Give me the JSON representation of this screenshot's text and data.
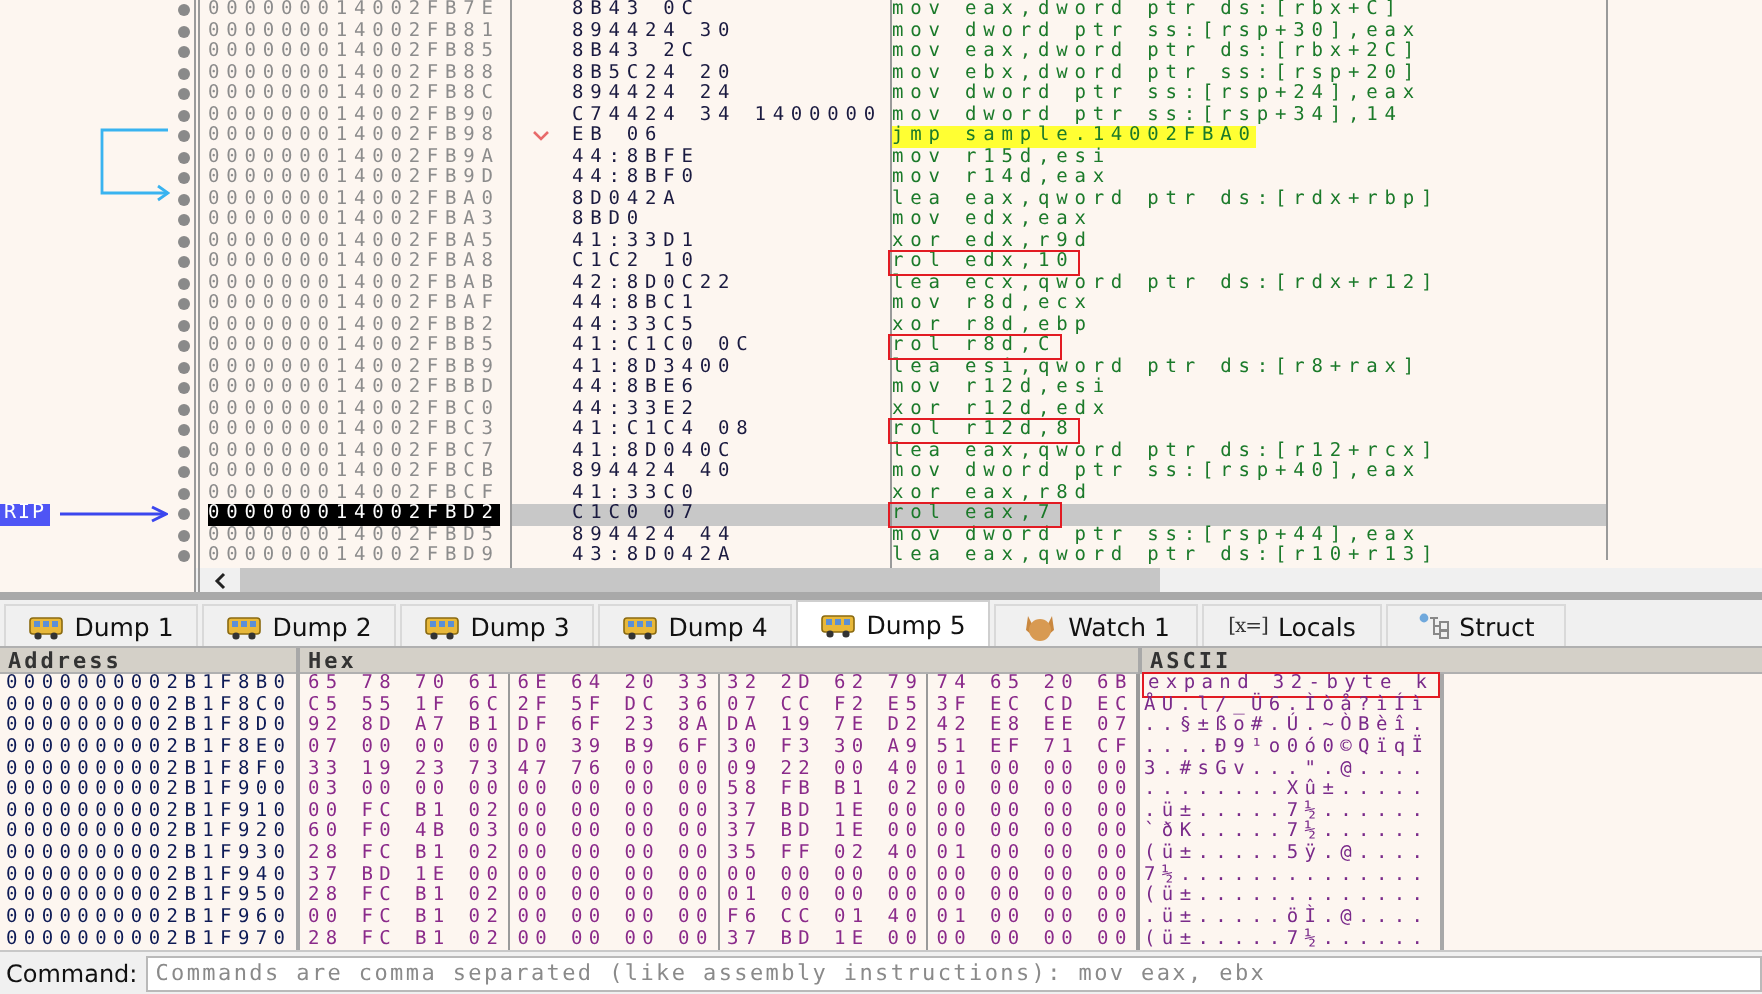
{
  "disassembly": {
    "rows": [
      {
        "address": "000000014002FB7E",
        "bytes": "8B43 0C",
        "instruction": "mov eax,dword ptr ds:[rbx+C]"
      },
      {
        "address": "000000014002FB81",
        "bytes": "894424 30",
        "instruction": "mov dword ptr ss:[rsp+30],eax"
      },
      {
        "address": "000000014002FB85",
        "bytes": "8B43 2C",
        "instruction": "mov eax,dword ptr ds:[rbx+2C]"
      },
      {
        "address": "000000014002FB88",
        "bytes": "8B5C24 20",
        "instruction": "mov ebx,dword ptr ss:[rsp+20]"
      },
      {
        "address": "000000014002FB8C",
        "bytes": "894424 24",
        "instruction": "mov dword ptr ss:[rsp+24],eax"
      },
      {
        "address": "000000014002FB90",
        "bytes": "C74424 34 1400000",
        "instruction": "mov dword ptr ss:[rsp+34],14"
      },
      {
        "address": "000000014002FB98",
        "bytes": "EB 06",
        "instruction": "jmp sample.14002FBA0",
        "highlight": true,
        "jump_source": true
      },
      {
        "address": "000000014002FB9A",
        "bytes": "44:8BFE",
        "instruction": "mov r15d,esi"
      },
      {
        "address": "000000014002FB9D",
        "bytes": "44:8BF0",
        "instruction": "mov r14d,eax"
      },
      {
        "address": "000000014002FBA0",
        "bytes": "8D042A",
        "instruction": "lea eax,qword ptr ds:[rdx+rbp]",
        "jump_target": true
      },
      {
        "address": "000000014002FBA3",
        "bytes": "8BD0",
        "instruction": "mov edx,eax"
      },
      {
        "address": "000000014002FBA5",
        "bytes": "41:33D1",
        "instruction": "xor edx,r9d"
      },
      {
        "address": "000000014002FBA8",
        "bytes": "C1C2 10",
        "instruction": "rol edx,10",
        "boxed": true
      },
      {
        "address": "000000014002FBAB",
        "bytes": "42:8D0C22",
        "instruction": "lea ecx,qword ptr ds:[rdx+r12]"
      },
      {
        "address": "000000014002FBAF",
        "bytes": "44:8BC1",
        "instruction": "mov r8d,ecx"
      },
      {
        "address": "000000014002FBB2",
        "bytes": "44:33C5",
        "instruction": "xor r8d,ebp"
      },
      {
        "address": "000000014002FBB5",
        "bytes": "41:C1C0 0C",
        "instruction": "rol r8d,C",
        "boxed": true
      },
      {
        "address": "000000014002FBB9",
        "bytes": "41:8D3400",
        "instruction": "lea esi,qword ptr ds:[r8+rax]"
      },
      {
        "address": "000000014002FBBD",
        "bytes": "44:8BE6",
        "instruction": "mov r12d,esi"
      },
      {
        "address": "000000014002FBC0",
        "bytes": "44:33E2",
        "instruction": "xor r12d,edx"
      },
      {
        "address": "000000014002FBC3",
        "bytes": "41:C1C4 08",
        "instruction": "rol r12d,8",
        "boxed": true
      },
      {
        "address": "000000014002FBC7",
        "bytes": "41:8D040C",
        "instruction": "lea eax,qword ptr ds:[r12+rcx]"
      },
      {
        "address": "000000014002FBCB",
        "bytes": "894424 40",
        "instruction": "mov dword ptr ss:[rsp+40],eax"
      },
      {
        "address": "000000014002FBCF",
        "bytes": "41:33C0",
        "instruction": "xor eax,r8d"
      },
      {
        "address": "000000014002FBD2",
        "bytes": "C1C0 07",
        "instruction": "rol eax,7",
        "boxed": true,
        "current": true,
        "label": "RIP"
      },
      {
        "address": "000000014002FBD5",
        "bytes": "894424 44",
        "instruction": "mov dword ptr ss:[rsp+44],eax"
      },
      {
        "address": "000000014002FBD9",
        "bytes": "43:8D042A",
        "instruction": "lea eax,qword ptr ds:[r10+r13]"
      }
    ]
  },
  "tabs": [
    {
      "label": "Dump 1",
      "kind": "dump",
      "selected": false
    },
    {
      "label": "Dump 2",
      "kind": "dump",
      "selected": false
    },
    {
      "label": "Dump 3",
      "kind": "dump",
      "selected": false
    },
    {
      "label": "Dump 4",
      "kind": "dump",
      "selected": false
    },
    {
      "label": "Dump 5",
      "kind": "dump",
      "selected": true
    },
    {
      "label": "Watch 1",
      "kind": "watch",
      "selected": false
    },
    {
      "label": "Locals",
      "kind": "locals",
      "symbol": "[x=]",
      "selected": false
    },
    {
      "label": "Struct",
      "kind": "struct",
      "selected": false
    }
  ],
  "dump": {
    "columns": [
      "Address",
      "Hex",
      "ASCII"
    ],
    "rows": [
      {
        "address": "0000000002B1F8B0",
        "hex": [
          "65 78 70 61",
          "6E 64 20 33",
          "32 2D 62 79",
          "74 65 20 6B"
        ],
        "ascii": "expand 32-byte k",
        "boxed": true
      },
      {
        "address": "0000000002B1F8C0",
        "hex": [
          "C5 55 1F 6C",
          "2F 5F DC 36",
          "07 CC F2 E5",
          "3F EC CD EC"
        ],
        "ascii": "ÅU.l/_Ü6.Ìòå?ìÍì"
      },
      {
        "address": "0000000002B1F8D0",
        "hex": [
          "92 8D A7 B1",
          "DF 6F 23 8A",
          "DA 19 7E D2",
          "42 E8 EE 07"
        ],
        "ascii": "..§±ßo#.Ú.~ÒBèî."
      },
      {
        "address": "0000000002B1F8E0",
        "hex": [
          "07 00 00 00",
          "D0 39 B9 6F",
          "30 F3 30 A9",
          "51 EF 71 CF"
        ],
        "ascii": "....Ð9¹o0ó0©QïqÏ"
      },
      {
        "address": "0000000002B1F8F0",
        "hex": [
          "33 19 23 73",
          "47 76 00 00",
          "09 22 00 40",
          "01 00 00 00"
        ],
        "ascii": "3.#sGv...\".@...."
      },
      {
        "address": "0000000002B1F900",
        "hex": [
          "03 00 00 00",
          "00 00 00 00",
          "58 FB B1 02",
          "00 00 00 00"
        ],
        "ascii": "........Xû±....."
      },
      {
        "address": "0000000002B1F910",
        "hex": [
          "00 FC B1 02",
          "00 00 00 00",
          "37 BD 1E 00",
          "00 00 00 00"
        ],
        "ascii": ".ü±.....7½......"
      },
      {
        "address": "0000000002B1F920",
        "hex": [
          "60 F0 4B 03",
          "00 00 00 00",
          "37 BD 1E 00",
          "00 00 00 00"
        ],
        "ascii": "`ðK.....7½......"
      },
      {
        "address": "0000000002B1F930",
        "hex": [
          "28 FC B1 02",
          "00 00 00 00",
          "35 FF 02 40",
          "01 00 00 00"
        ],
        "ascii": "(ü±.....5ÿ.@...."
      },
      {
        "address": "0000000002B1F940",
        "hex": [
          "37 BD 1E 00",
          "00 00 00 00",
          "00 00 00 00",
          "00 00 00 00"
        ],
        "ascii": "7½.............."
      },
      {
        "address": "0000000002B1F950",
        "hex": [
          "28 FC B1 02",
          "00 00 00 00",
          "01 00 00 00",
          "00 00 00 00"
        ],
        "ascii": "(ü±............."
      },
      {
        "address": "0000000002B1F960",
        "hex": [
          "00 FC B1 02",
          "00 00 00 00",
          "F6 CC 01 40",
          "01 00 00 00"
        ],
        "ascii": ".ü±.....öÌ.@...."
      },
      {
        "address": "0000000002B1F970",
        "hex": [
          "28 FC B1 02",
          "00 00 00 00",
          "37 BD 1E 00",
          "00 00 00 00"
        ],
        "ascii": "(ü±.....7½......"
      }
    ]
  },
  "command": {
    "label": "Command:",
    "placeholder": "Commands are comma separated (like assembly instructions): mov eax, ebx"
  }
}
